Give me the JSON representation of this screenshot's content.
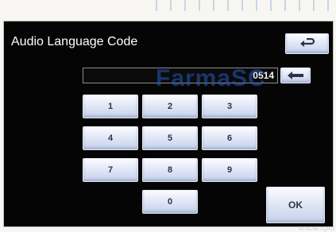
{
  "screen": {
    "title": "Audio Language Code",
    "code_value": "0514",
    "back_icon": "return-arrow-icon",
    "backspace_icon": "backspace-arrow-icon"
  },
  "keypad": {
    "k1": "1",
    "k2": "2",
    "k3": "3",
    "k4": "4",
    "k5": "5",
    "k6": "6",
    "k7": "7",
    "k8": "8",
    "k9": "9",
    "k0": "0"
  },
  "actions": {
    "ok_label": "OK"
  },
  "footer": {
    "code": "AY5C4E7QAU"
  },
  "overlay": {
    "watermark": "FarmaSC"
  },
  "colors": {
    "screen_bg": "#050505",
    "button_top": "#fbfcff",
    "button_bottom": "#c6d1ea",
    "watermark": "#285abe"
  }
}
